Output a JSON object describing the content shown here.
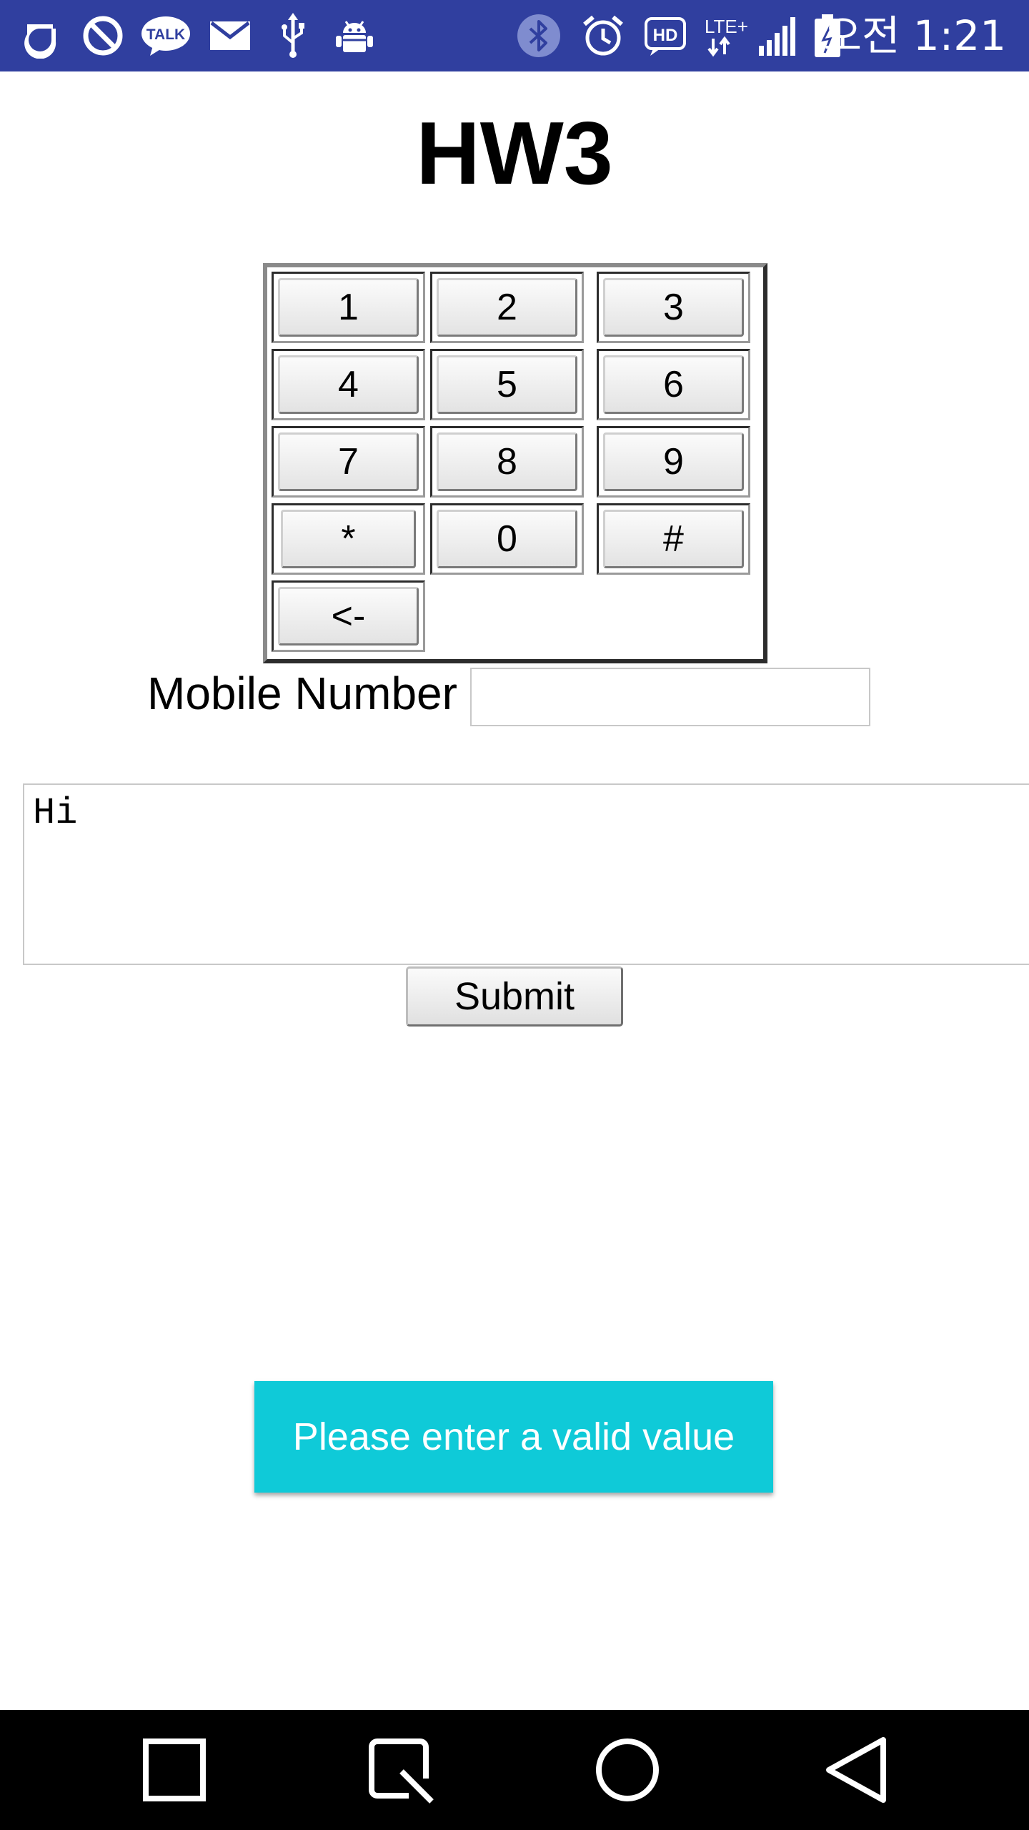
{
  "status_bar": {
    "time": "오전 1:21",
    "icons": [
      "olleh-icon",
      "block-icon",
      "kakaotalk-icon",
      "mail-icon",
      "usb-icon",
      "android-debug-icon",
      "bluetooth-icon",
      "alarm-icon",
      "hd-voice-icon",
      "lte-icon",
      "signal-icon",
      "battery-charging-icon"
    ],
    "kakaotalk_text": "TALK",
    "hd_text": "HD",
    "lte_text": "LTE+",
    "color": "#303f9f"
  },
  "page": {
    "title": "HW3"
  },
  "keypad": {
    "keys": [
      "1",
      "2",
      "3",
      "4",
      "5",
      "6",
      "7",
      "8",
      "9",
      "*",
      "0",
      "#"
    ],
    "backspace": "<-"
  },
  "form": {
    "mobile_label": "Mobile Number",
    "mobile_value": "",
    "message_value": "Hi",
    "submit_label": "Submit"
  },
  "toast": {
    "message": "Please enter a valid value",
    "color": "#0fcad8"
  },
  "nav_bar": {
    "buttons": [
      "recents-square-icon",
      "qslide-icon",
      "home-circle-icon",
      "back-triangle-icon"
    ]
  }
}
